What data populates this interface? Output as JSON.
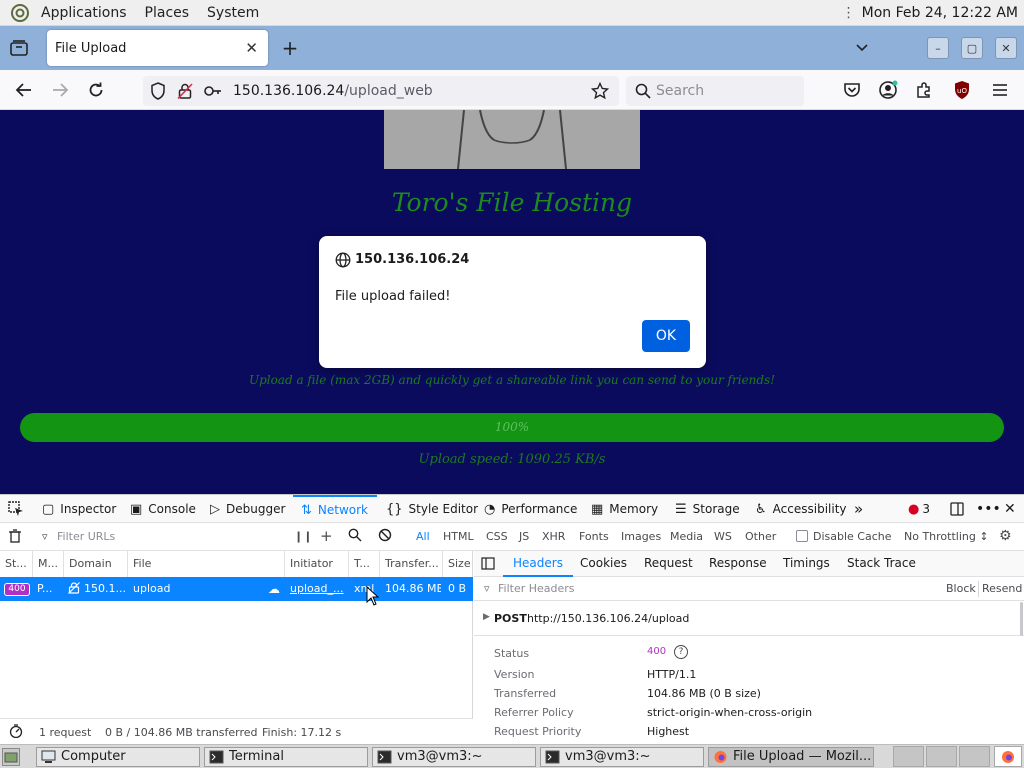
{
  "top_panel": {
    "menus": [
      "Applications",
      "Places",
      "System"
    ],
    "clock": "Mon Feb 24, 12:22 AM"
  },
  "browser": {
    "tab_title": "File Upload",
    "url_host": "150.136.106.24",
    "url_path": "/upload_web",
    "search_placeholder": "Search"
  },
  "page": {
    "site_title": "Toro's File Hosting",
    "tagline": "Upload a file (max 2GB) and quickly get a shareable link you can send to your friends!",
    "progress_label": "100%",
    "progress_value": 100,
    "upload_speed": "Upload speed: 1090.25 KB/s"
  },
  "dialog": {
    "host": "150.136.106.24",
    "message": "File upload failed!",
    "ok_label": "OK"
  },
  "devtools": {
    "tabs": [
      "Inspector",
      "Console",
      "Debugger",
      "Network",
      "Style Editor",
      "Performance",
      "Memory",
      "Storage",
      "Accessibility"
    ],
    "active_tab": "Network",
    "error_count": "3",
    "filter_placeholder": "Filter URLs",
    "type_filters": [
      "All",
      "HTML",
      "CSS",
      "JS",
      "XHR",
      "Fonts",
      "Images",
      "Media",
      "WS",
      "Other"
    ],
    "disable_cache_label": "Disable Cache",
    "throttling_label": "No Throttling ↕",
    "columns": [
      "St...",
      "M...",
      "Domain",
      "File",
      "Initiator",
      "T...",
      "Transfer...",
      "Size"
    ],
    "request": {
      "status": "400",
      "method": "P...",
      "domain": "150.1...",
      "file": "upload",
      "initiator": "upload_...",
      "type": "xml",
      "transferred": "104.86 MB",
      "size": "0 B"
    },
    "summary": {
      "requests": "1 request",
      "transferred": "0 B / 104.86 MB transferred",
      "finish": "Finish: 17.12 s"
    },
    "detail_tabs": [
      "Headers",
      "Cookies",
      "Request",
      "Response",
      "Timings",
      "Stack Trace"
    ],
    "active_detail_tab": "Headers",
    "filter_headers_placeholder": "Filter Headers",
    "block_label": "Block",
    "resend_label": "Resend",
    "post_method": "POST",
    "post_url": "http://150.136.106.24/upload",
    "details": [
      {
        "key": "Status",
        "value": "400"
      },
      {
        "key": "Version",
        "value": "HTTP/1.1"
      },
      {
        "key": "Transferred",
        "value": "104.86 MB (0 B size)"
      },
      {
        "key": "Referrer Policy",
        "value": "strict-origin-when-cross-origin"
      },
      {
        "key": "Request Priority",
        "value": "Highest"
      }
    ]
  },
  "taskbar": {
    "tasks": [
      "Computer",
      "Terminal",
      "vm3@vm3:~",
      "vm3@vm3:~",
      "File Upload — Mozil..."
    ]
  },
  "colors": {
    "page_bg": "#0b0b5e",
    "title_green": "#1e8a1e",
    "progress_green": "#139413",
    "accent_blue": "#0a84ff",
    "status_400": "#b22fc6",
    "ok_button": "#0061e0"
  }
}
